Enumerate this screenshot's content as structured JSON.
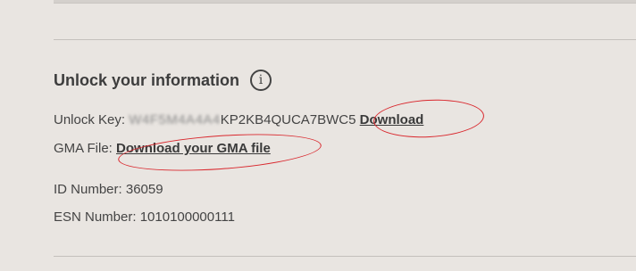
{
  "section": {
    "title": "Unlock your information",
    "info_icon_glyph": "i"
  },
  "unlock_key": {
    "label": "Unlock Key:",
    "redacted": "W4F5M4A4A4",
    "visible_suffix": "KP2KB4QUCA7BWC5",
    "download_label": "Download"
  },
  "gma_file": {
    "label": "GMA File:",
    "link_label": "Download your GMA file"
  },
  "id_number": {
    "text": "ID Number: 36059"
  },
  "esn_number": {
    "text": "ESN Number: 1010100000111"
  },
  "annotation_color": "#d9262c"
}
